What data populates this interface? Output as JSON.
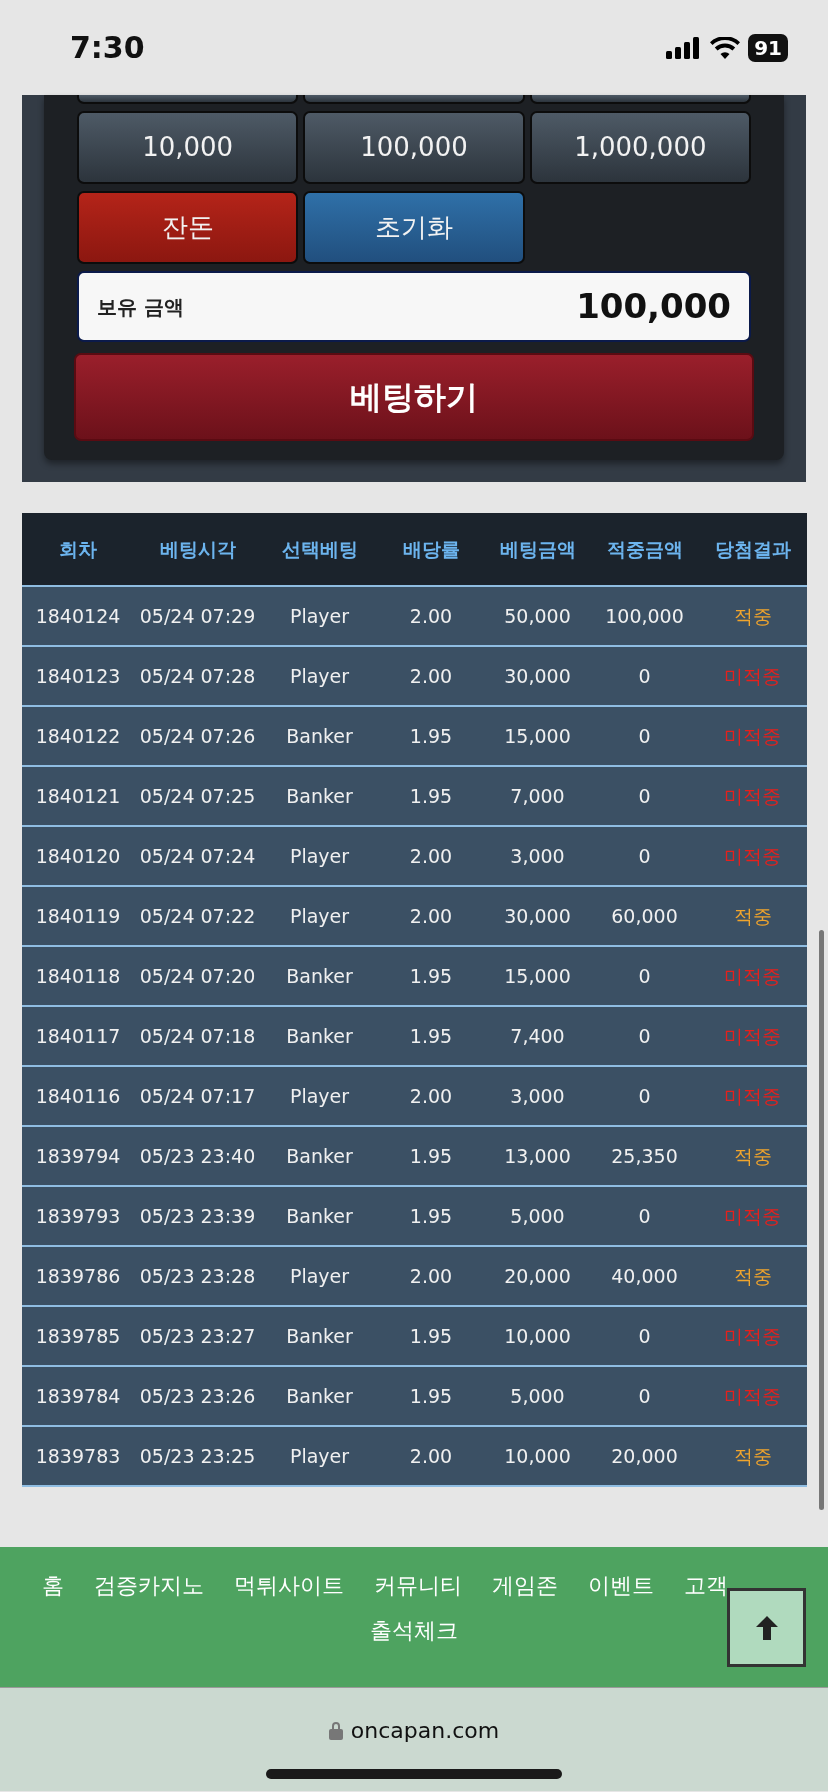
{
  "status_bar": {
    "time": "7:30",
    "battery": "91"
  },
  "bet_panel": {
    "amount_buttons": [
      "10,000",
      "100,000",
      "1,000,000"
    ],
    "action_buttons": [
      {
        "label": "잔돈",
        "kind": "danger"
      },
      {
        "label": "초기화",
        "kind": "primary"
      }
    ],
    "balance": {
      "label": "보유 금액",
      "value": "100,000"
    },
    "bet_button": "베팅하기"
  },
  "history_table": {
    "columns": [
      "회차",
      "베팅시각",
      "선택베팅",
      "배당률",
      "베팅금액",
      "적중금액",
      "당첨결과"
    ],
    "rows": [
      {
        "cells": [
          "1840124",
          "05/24 07:29",
          "Player",
          "2.00",
          "50,000",
          "100,000"
        ],
        "result": "적중",
        "won": true
      },
      {
        "cells": [
          "1840123",
          "05/24 07:28",
          "Player",
          "2.00",
          "30,000",
          "0"
        ],
        "result": "미적중",
        "won": false
      },
      {
        "cells": [
          "1840122",
          "05/24 07:26",
          "Banker",
          "1.95",
          "15,000",
          "0"
        ],
        "result": "미적중",
        "won": false
      },
      {
        "cells": [
          "1840121",
          "05/24 07:25",
          "Banker",
          "1.95",
          "7,000",
          "0"
        ],
        "result": "미적중",
        "won": false
      },
      {
        "cells": [
          "1840120",
          "05/24 07:24",
          "Player",
          "2.00",
          "3,000",
          "0"
        ],
        "result": "미적중",
        "won": false
      },
      {
        "cells": [
          "1840119",
          "05/24 07:22",
          "Player",
          "2.00",
          "30,000",
          "60,000"
        ],
        "result": "적중",
        "won": true
      },
      {
        "cells": [
          "1840118",
          "05/24 07:20",
          "Banker",
          "1.95",
          "15,000",
          "0"
        ],
        "result": "미적중",
        "won": false
      },
      {
        "cells": [
          "1840117",
          "05/24 07:18",
          "Banker",
          "1.95",
          "7,400",
          "0"
        ],
        "result": "미적중",
        "won": false
      },
      {
        "cells": [
          "1840116",
          "05/24 07:17",
          "Player",
          "2.00",
          "3,000",
          "0"
        ],
        "result": "미적중",
        "won": false
      },
      {
        "cells": [
          "1839794",
          "05/23 23:40",
          "Banker",
          "1.95",
          "13,000",
          "25,350"
        ],
        "result": "적중",
        "won": true
      },
      {
        "cells": [
          "1839793",
          "05/23 23:39",
          "Banker",
          "1.95",
          "5,000",
          "0"
        ],
        "result": "미적중",
        "won": false
      },
      {
        "cells": [
          "1839786",
          "05/23 23:28",
          "Player",
          "2.00",
          "20,000",
          "40,000"
        ],
        "result": "적중",
        "won": true
      },
      {
        "cells": [
          "1839785",
          "05/23 23:27",
          "Banker",
          "1.95",
          "10,000",
          "0"
        ],
        "result": "미적중",
        "won": false
      },
      {
        "cells": [
          "1839784",
          "05/23 23:26",
          "Banker",
          "1.95",
          "5,000",
          "0"
        ],
        "result": "미적중",
        "won": false
      },
      {
        "cells": [
          "1839783",
          "05/23 23:25",
          "Player",
          "2.00",
          "10,000",
          "20,000"
        ],
        "result": "적중",
        "won": true
      }
    ]
  },
  "footer": {
    "menu": [
      "홈",
      "검증카지노",
      "먹튀사이트",
      "커뮤니티",
      "게임존",
      "이벤트",
      "고객",
      "출석체크"
    ]
  },
  "browser_bar": {
    "url": "oncapan.com"
  }
}
